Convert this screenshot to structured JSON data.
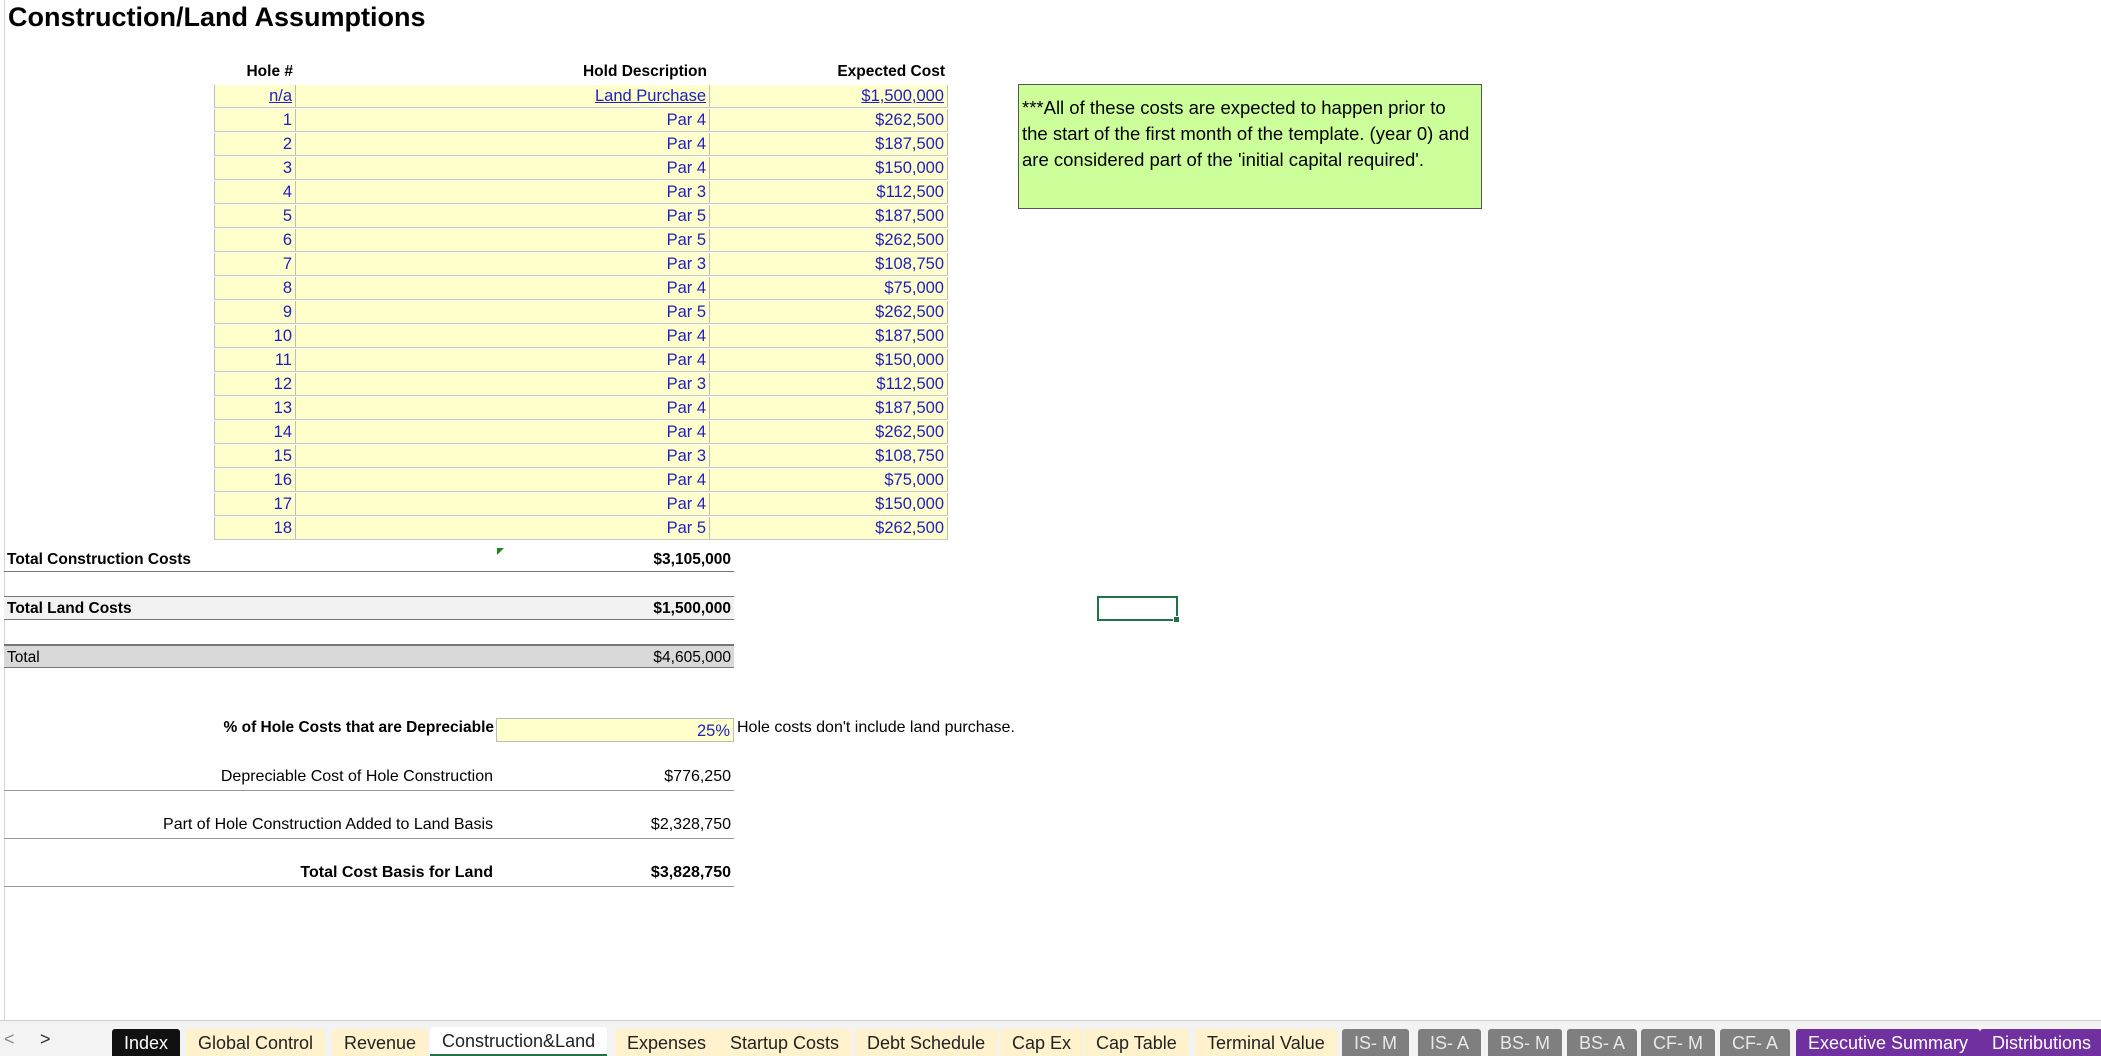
{
  "title": "Construction/Land Assumptions",
  "headers": {
    "hole": "Hole #",
    "description": "Hold Description",
    "cost": "Expected Cost"
  },
  "holes": [
    {
      "hole": "n/a",
      "description": "Land Purchase",
      "cost": "$1,500,000"
    },
    {
      "hole": "1",
      "description": "Par 4",
      "cost": "$262,500"
    },
    {
      "hole": "2",
      "description": "Par 4",
      "cost": "$187,500"
    },
    {
      "hole": "3",
      "description": "Par 4",
      "cost": "$150,000"
    },
    {
      "hole": "4",
      "description": "Par 3",
      "cost": "$112,500"
    },
    {
      "hole": "5",
      "description": "Par 5",
      "cost": "$187,500"
    },
    {
      "hole": "6",
      "description": "Par 5",
      "cost": "$262,500"
    },
    {
      "hole": "7",
      "description": "Par 3",
      "cost": "$108,750"
    },
    {
      "hole": "8",
      "description": "Par 4",
      "cost": "$75,000"
    },
    {
      "hole": "9",
      "description": "Par 5",
      "cost": "$262,500"
    },
    {
      "hole": "10",
      "description": "Par 4",
      "cost": "$187,500"
    },
    {
      "hole": "11",
      "description": "Par 4",
      "cost": "$150,000"
    },
    {
      "hole": "12",
      "description": "Par 3",
      "cost": "$112,500"
    },
    {
      "hole": "13",
      "description": "Par 4",
      "cost": "$187,500"
    },
    {
      "hole": "14",
      "description": "Par 4",
      "cost": "$262,500"
    },
    {
      "hole": "15",
      "description": "Par 3",
      "cost": "$108,750"
    },
    {
      "hole": "16",
      "description": "Par 4",
      "cost": "$75,000"
    },
    {
      "hole": "17",
      "description": "Par 4",
      "cost": "$150,000"
    },
    {
      "hole": "18",
      "description": "Par 5",
      "cost": "$262,500"
    }
  ],
  "totals": {
    "construction": {
      "label": "Total Construction Costs",
      "value": "$3,105,000"
    },
    "land": {
      "label": "Total Land Costs",
      "value": "$1,500,000"
    },
    "total": {
      "label": "Total",
      "value": "$4,605,000"
    }
  },
  "depreciation": {
    "label": "% of Hole Costs that are Depreciable",
    "value": "25%",
    "note": "Hole costs don't include land purchase."
  },
  "calcs": {
    "depreciable": {
      "label": "Depreciable Cost of Hole Construction",
      "value": "$776,250"
    },
    "land_basis": {
      "label": "Part of Hole Construction Added to Land Basis",
      "value": "$2,328,750"
    },
    "total_basis": {
      "label": "Total Cost Basis for Land",
      "value": "$3,828,750"
    }
  },
  "note_box": "***All of these costs are expected to happen prior to the start of the first month of the template. (year 0) and are considered part of the 'initial capital required'.",
  "tabs": {
    "nav_prev": "<",
    "nav_next": ">",
    "items": [
      "Index",
      "Global Control",
      "Revenue",
      "Construction&Land",
      "Expenses",
      "Startup Costs",
      "Debt Schedule",
      "Cap Ex",
      "Cap Table",
      "Terminal Value",
      "IS- M",
      "IS- A",
      "BS- M",
      "BS- A",
      "CF- M",
      "CF- A",
      "Executive Summary",
      "Distributions"
    ],
    "active": "Construction&Land"
  },
  "colors": {
    "input_fill": "#ffffcc",
    "input_text": "#2020c0",
    "note_fill": "#ccff99",
    "tab_yellow": "#fff2cc",
    "tab_gray": "#7f7f7f",
    "tab_purple": "#7030a0",
    "selection": "#217346"
  }
}
